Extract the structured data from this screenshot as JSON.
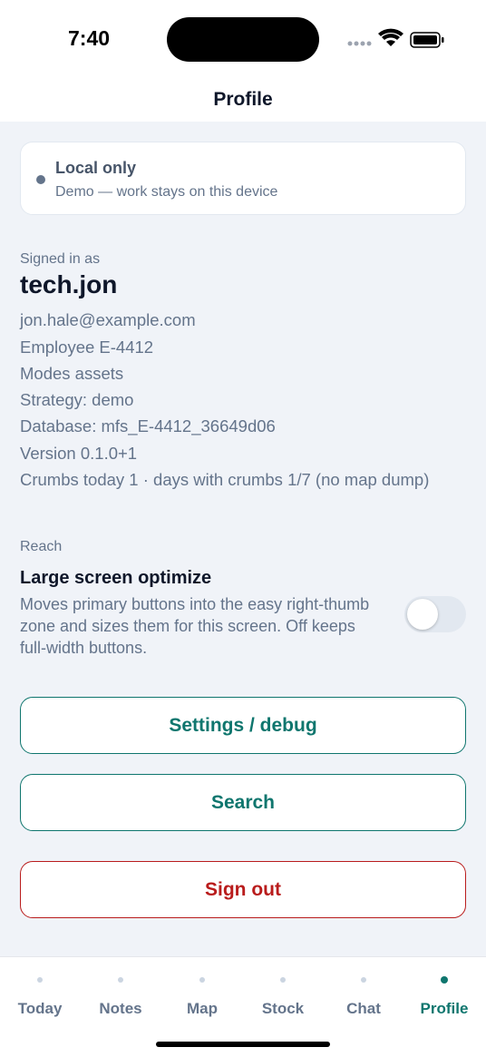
{
  "status": {
    "time": "7:40"
  },
  "header": {
    "title": "Profile"
  },
  "mode_card": {
    "title": "Local only",
    "subtitle": "Demo — work stays on this device"
  },
  "account": {
    "signed_in_label": "Signed in as",
    "username": "tech.jon",
    "email": "jon.hale@example.com",
    "employee": "Employee E-4412",
    "modes": "Modes assets",
    "strategy": "Strategy: demo",
    "database": "Database: mfs_E-4412_36649d06",
    "version": "Version 0.1.0+1",
    "crumbs": "Crumbs today 1 · days with crumbs 1/7 (no map dump)"
  },
  "reach": {
    "section_label": "Reach",
    "title": "Large screen optimize",
    "description": "Moves primary buttons into the easy right-thumb zone and sizes them for this screen. Off keeps full-width buttons.",
    "enabled": false
  },
  "buttons": {
    "settings": "Settings / debug",
    "search": "Search",
    "sign_out": "Sign out"
  },
  "tabs": [
    {
      "label": "Today",
      "active": false
    },
    {
      "label": "Notes",
      "active": false
    },
    {
      "label": "Map",
      "active": false
    },
    {
      "label": "Stock",
      "active": false
    },
    {
      "label": "Chat",
      "active": false
    },
    {
      "label": "Profile",
      "active": true
    }
  ],
  "colors": {
    "accent": "#0f766e",
    "danger": "#b91c1c",
    "background": "#f0f3f8"
  }
}
